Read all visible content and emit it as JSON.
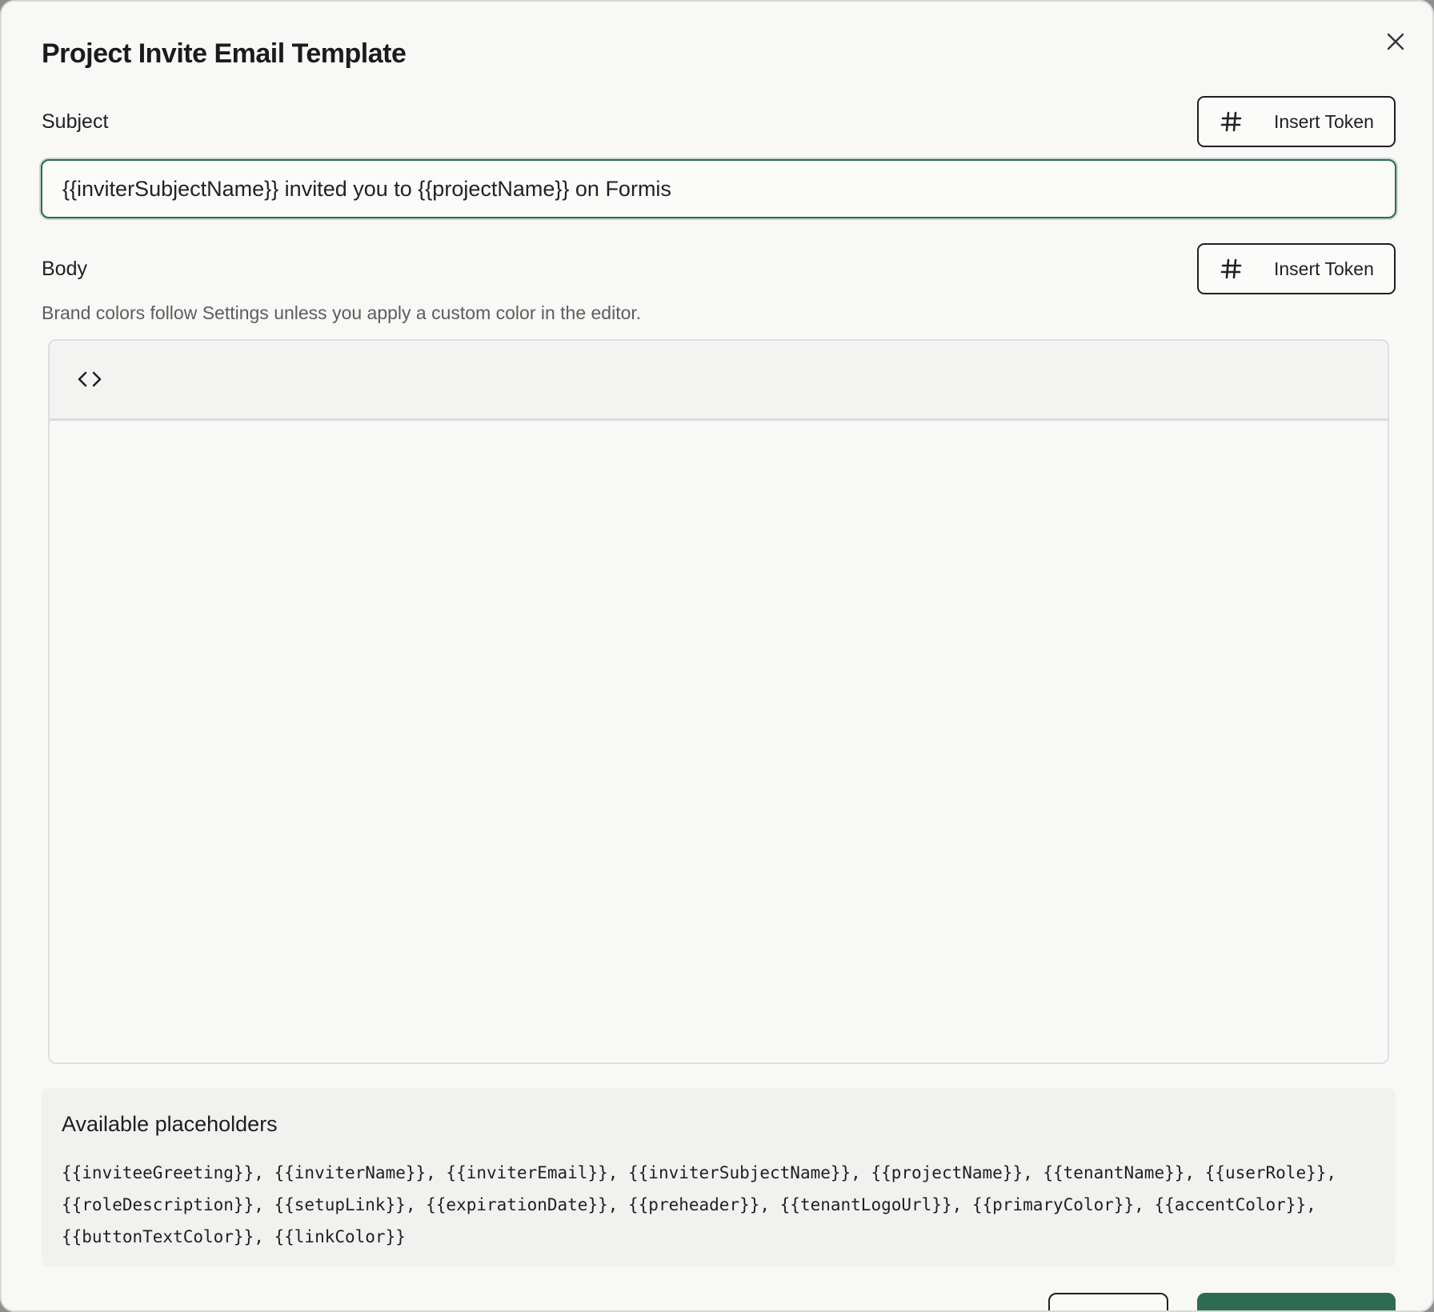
{
  "dialog": {
    "title": "Project Invite Email Template"
  },
  "subject": {
    "label": "Subject",
    "value": "{{inviterSubjectName}} invited you to {{projectName}} on Formis",
    "insert_token_label": "Insert Token"
  },
  "body": {
    "label": "Body",
    "helper_text": "Brand colors follow Settings unless you apply a custom color in the editor.",
    "insert_token_label": "Insert Token"
  },
  "placeholders": {
    "title": "Available placeholders",
    "list": "{{inviteeGreeting}}, {{inviterName}}, {{inviterEmail}}, {{inviterSubjectName}}, {{projectName}}, {{tenantName}}, {{userRole}}, {{roleDescription}}, {{setupLink}}, {{expirationDate}}, {{preheader}}, {{tenantLogoUrl}}, {{primaryColor}}, {{accentColor}}, {{buttonTextColor}}, {{linkColor}}"
  },
  "icons": {
    "close": "close-icon",
    "token": "hash-icon",
    "code": "code-icon"
  },
  "colors": {
    "accent": "#2f6b52",
    "surface": "#f8f8f6"
  }
}
